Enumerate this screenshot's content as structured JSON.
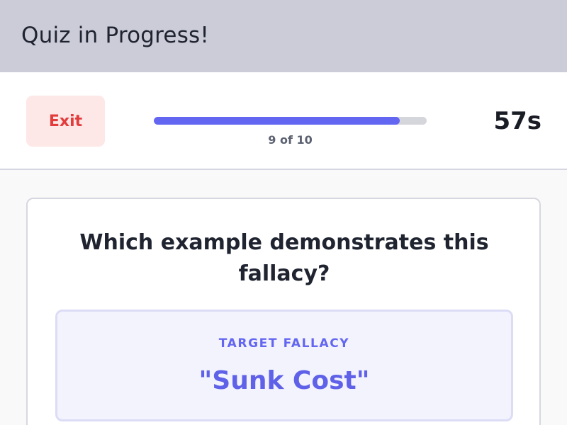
{
  "header": {
    "title": "Quiz in Progress!"
  },
  "status": {
    "exit_label": "Exit",
    "progress_current": 9,
    "progress_total": 10,
    "progress_label": "9 of 10",
    "progress_fraction": 0.9,
    "timer": "57s"
  },
  "question": {
    "text": "Which example demonstrates this fallacy?",
    "target_label": "TARGET FALLACY",
    "target_value": "\"Sunk Cost\""
  },
  "colors": {
    "accent": "#6366f1",
    "exit_text": "#e23c3c",
    "exit_bg": "#fde7e7",
    "header_bg": "#cccbd8"
  }
}
